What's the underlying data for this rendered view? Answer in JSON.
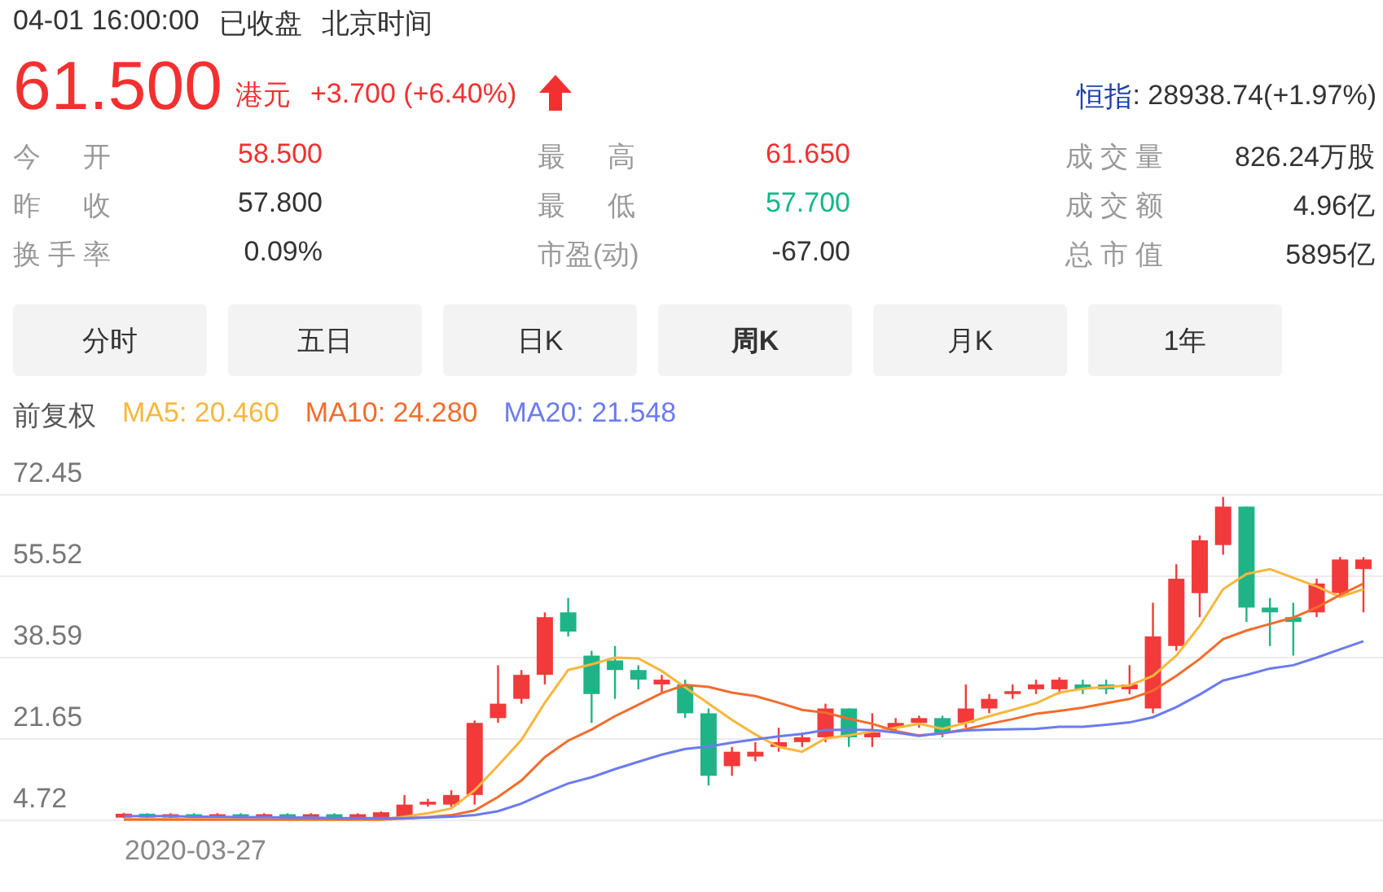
{
  "status_line": {
    "time": "04-01 16:00:00",
    "state": "已收盘",
    "timezone": "北京时间"
  },
  "quote": {
    "price": "61.500",
    "currency": "港元",
    "change": "+3.700 (+6.40%)",
    "rising": true,
    "index_label": "恒指",
    "index_value": ": 28938.74(+1.97%)"
  },
  "stats": [
    {
      "label": "今 开",
      "value": "58.500",
      "color": "#f23030"
    },
    {
      "label": "最 高",
      "value": "61.650",
      "color": "#f23030"
    },
    {
      "label": "成交量",
      "value": "826.24万股",
      "color": "#333333"
    },
    {
      "label": "昨 收",
      "value": "57.800",
      "color": "#333333"
    },
    {
      "label": "最 低",
      "value": "57.700",
      "color": "#12b886"
    },
    {
      "label": "成交额",
      "value": "4.96亿",
      "color": "#333333"
    },
    {
      "label": "换手率",
      "value": "0.09%",
      "color": "#333333"
    },
    {
      "label": "市盈(动)",
      "value": "-67.00",
      "color": "#333333"
    },
    {
      "label": "总市值",
      "value": "5895亿",
      "color": "#333333"
    }
  ],
  "tabs": [
    {
      "label": "分时",
      "selected": false
    },
    {
      "label": "五日",
      "selected": false
    },
    {
      "label": "日K",
      "selected": false
    },
    {
      "label": "周K",
      "selected": true
    },
    {
      "label": "月K",
      "selected": false
    },
    {
      "label": "1年",
      "selected": false
    }
  ],
  "chart": {
    "adjust_label": "前复权",
    "start_date": "2020-03-27",
    "candles": {
      "chart_data": {
        "type": "candlestick",
        "grid": true,
        "ylim": [
          4.72,
          72.45
        ],
        "yticks": [
          {
            "value": 4.72,
            "label": "4.72"
          },
          {
            "value": 21.65,
            "label": "21.65"
          },
          {
            "value": 38.59,
            "label": "38.59"
          },
          {
            "value": 55.52,
            "label": "55.52"
          },
          {
            "value": 72.45,
            "label": "72.45"
          }
        ],
        "ohlc": [
          [
            5.3,
            6.3,
            5.2,
            6.1
          ],
          [
            6.1,
            6.2,
            5.2,
            5.3
          ],
          [
            5.3,
            6.2,
            5.2,
            6.0
          ],
          [
            6.0,
            6.2,
            5.2,
            5.3
          ],
          [
            5.3,
            6.2,
            5.2,
            6.0
          ],
          [
            6.0,
            6.2,
            5.2,
            5.3
          ],
          [
            5.3,
            6.2,
            5.2,
            6.0
          ],
          [
            6.0,
            6.2,
            5.2,
            5.3
          ],
          [
            5.3,
            6.2,
            5.2,
            6.0
          ],
          [
            6.0,
            6.2,
            5.2,
            5.3
          ],
          [
            5.3,
            6.2,
            5.2,
            6.0
          ],
          [
            5.4,
            6.6,
            5.3,
            6.4
          ],
          [
            5.4,
            10,
            5,
            8
          ],
          [
            8,
            9.2,
            7.6,
            8.6
          ],
          [
            8,
            11,
            7.5,
            10
          ],
          [
            10,
            25.5,
            8,
            25
          ],
          [
            26,
            37,
            25,
            29
          ],
          [
            30,
            36,
            29,
            35
          ],
          [
            35,
            48,
            33,
            47
          ],
          [
            48,
            51,
            43,
            44
          ],
          [
            39,
            40,
            25,
            31
          ],
          [
            38,
            41,
            30,
            36
          ],
          [
            36,
            37,
            32,
            34
          ],
          [
            33,
            35,
            31,
            34
          ],
          [
            33,
            34,
            26,
            27
          ],
          [
            27,
            28,
            12,
            14
          ],
          [
            16,
            20,
            14,
            19
          ],
          [
            18,
            21,
            17,
            19
          ],
          [
            20,
            24,
            19,
            21
          ],
          [
            21,
            23,
            20,
            22
          ],
          [
            22,
            29,
            21,
            28
          ],
          [
            28,
            28,
            20,
            22
          ],
          [
            22,
            27,
            20,
            23
          ],
          [
            24,
            26,
            23,
            25
          ],
          [
            25,
            26.5,
            24,
            26
          ],
          [
            26,
            26.5,
            22,
            23
          ],
          [
            25,
            33,
            24,
            28
          ],
          [
            28,
            31,
            27,
            30
          ],
          [
            31,
            33,
            30,
            31.6
          ],
          [
            32,
            34,
            31,
            33
          ],
          [
            32,
            34.5,
            31,
            34
          ],
          [
            33,
            34,
            31,
            32
          ],
          [
            33,
            34,
            31,
            32
          ],
          [
            32,
            37,
            31,
            33
          ],
          [
            28,
            50,
            27,
            43
          ],
          [
            41,
            58,
            40,
            55
          ],
          [
            52,
            64,
            47,
            63
          ],
          [
            62,
            72,
            60,
            70
          ],
          [
            70,
            70,
            46,
            49
          ],
          [
            49,
            51,
            41,
            48
          ],
          [
            47,
            50,
            39,
            46
          ],
          [
            48,
            55,
            47,
            54
          ],
          [
            52,
            59.5,
            51,
            59
          ],
          [
            57,
            59.5,
            48,
            59
          ]
        ]
      }
    },
    "averages": {
      "chart_data": {
        "type": "line",
        "ylim": [
          4.72,
          72.45
        ],
        "series": [
          {
            "name": "MA5: 20.460",
            "color": "#f7b73c",
            "values": [
              4.9,
              4.9,
              4.9,
              4.9,
              4.9,
              4.9,
              4.9,
              4.9,
              4.9,
              4.9,
              4.9,
              4.9,
              5.5,
              6.2,
              7.2,
              11,
              16.1,
              21.5,
              29.2,
              36,
              37.2,
              38.6,
              38.4,
              35.8,
              32.4,
              29,
              25.6,
              22.6,
              20,
              19,
              21.8,
              22.4,
              23.2,
              24,
              24.8,
              23.8,
              25,
              26.4,
              27.7,
              29.1,
              31.3,
              32.1,
              32.5,
              32.8,
              34.8,
              39,
              45.2,
              52.8,
              56,
              57,
              55.2,
              53.4,
              51.2,
              52.8
            ]
          },
          {
            "name": "MA10: 24.280",
            "color": "#f36c2c",
            "values": [
              4.9,
              4.9,
              4.9,
              4.9,
              4.9,
              4.9,
              4.9,
              4.9,
              4.9,
              4.9,
              4.9,
              4.9,
              5.1,
              5.4,
              5.8,
              6.8,
              9.6,
              13,
              17.9,
              21.3,
              23.6,
              26.4,
              28.8,
              31.2,
              32.9,
              32.5,
              31.3,
              30.6,
              29.2,
              27.7,
              27.1,
              25.9,
              24.8,
              23.3,
              22.4,
              22.8,
              23.7,
              24.8,
              25.8,
              26.9,
              27.5,
              28.2,
              29.1,
              30,
              31.7,
              34.8,
              38.3,
              42.4,
              44.2,
              45.6,
              46.9,
              49,
              51.6,
              54
            ]
          },
          {
            "name": "MA20: 21.548",
            "color": "#6b7bf0",
            "values": [
              5.6,
              5.6,
              5.6,
              5.5,
              5.5,
              5.4,
              5.4,
              5.3,
              5.3,
              5.2,
              5.2,
              5.2,
              5.2,
              5.3,
              5.5,
              5.8,
              6.6,
              8.2,
              10.4,
              12.4,
              13.7,
              15.4,
              16.9,
              18.4,
              19.6,
              20.1,
              20.9,
              21.6,
              22.2,
              22.7,
              23.5,
              23.6,
              23.5,
              23,
              22.3,
              22.9,
              23.4,
              23.6,
              23.7,
              23.8,
              24.2,
              24.2,
              24.6,
              25.1,
              26.2,
              28.3,
              30.9,
              33.8,
              35,
              36.3,
              37,
              38.6,
              40.3,
              42
            ]
          }
        ]
      }
    }
  }
}
